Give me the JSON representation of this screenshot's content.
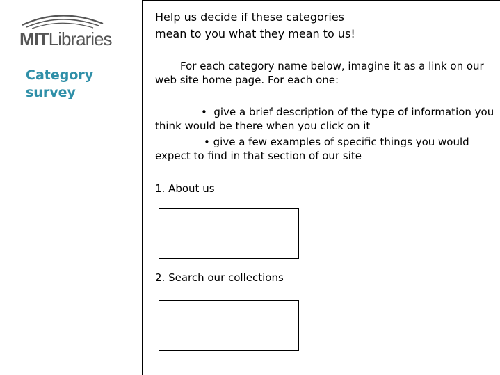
{
  "sidebar": {
    "logo": {
      "mit": "MIT",
      "libraries": "Libraries"
    },
    "title": "Category survey"
  },
  "main": {
    "heading_line1": "Help us decide if these categories",
    "heading_line2": "mean to you what they mean to us!",
    "intro": "For each category name below, imagine it as a link on our web site home page. For each one:",
    "bullets": [
      "give a brief description of the type of information you think would be there when you click on it",
      "give a few examples of specific things you would expect to find in that section of our site"
    ],
    "bullet_char": "•",
    "questions": [
      {
        "label": "1. About us",
        "value": ""
      },
      {
        "label": "2. Search our collections",
        "value": ""
      }
    ]
  },
  "colors": {
    "title": "#2f8fa8",
    "logo": "#555555",
    "border": "#000000"
  }
}
